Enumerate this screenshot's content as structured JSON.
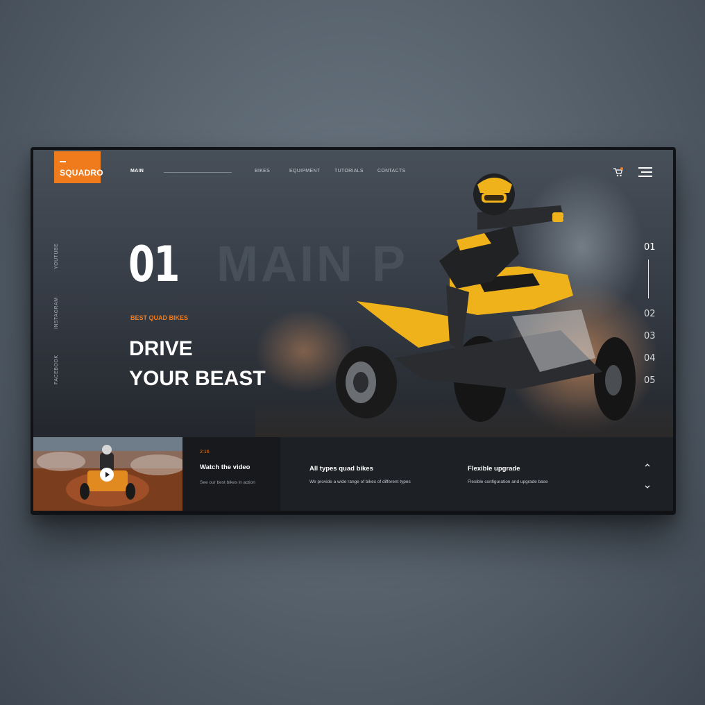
{
  "brand": {
    "name": "SQUADRO",
    "accent": "#f07b1d"
  },
  "nav": {
    "main": "MAIN",
    "items": [
      "BIKES",
      "EQUIPMENT",
      "TUTORIALS",
      "CONTACTS"
    ]
  },
  "icons": {
    "cart": "cart-icon",
    "menu": "hamburger-menu-icon",
    "play": "play-icon"
  },
  "social": [
    "YOUTUBE",
    "INSTAGRAM",
    "FACEBOOK"
  ],
  "hero": {
    "number": "01",
    "background_word": "MAIN P",
    "kicker": "BEST QUAD BIKES",
    "headline_line1": "DRIVE",
    "headline_line2": "YOUR BEAST"
  },
  "pager": [
    "01",
    "02",
    "03",
    "04",
    "05"
  ],
  "video": {
    "duration": "2:16",
    "title": "Watch the video",
    "description": "See our best bikes in action"
  },
  "features": [
    {
      "title": "All types quad bikes",
      "description": "We provide a wide range of bikes of different types"
    },
    {
      "title": "Flexible upgrade",
      "description": "Flexible configuration and upgrade base"
    }
  ]
}
